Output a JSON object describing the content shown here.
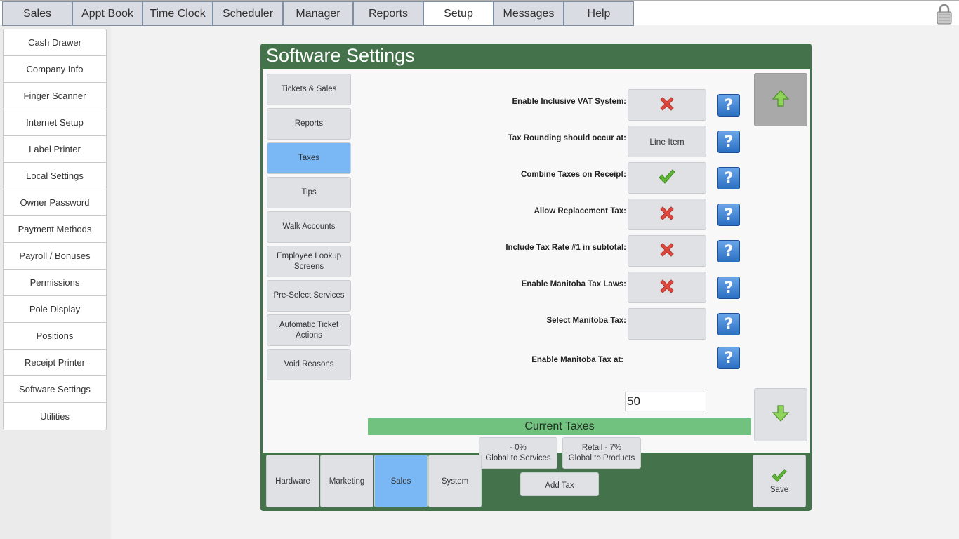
{
  "topnav": {
    "tabs": [
      {
        "label": "Sales"
      },
      {
        "label": "Appt Book"
      },
      {
        "label": "Time Clock"
      },
      {
        "label": "Scheduler"
      },
      {
        "label": "Manager"
      },
      {
        "label": "Reports"
      },
      {
        "label": "Setup",
        "active": true
      },
      {
        "label": "Messages"
      },
      {
        "label": "Help"
      }
    ],
    "lock_icon": "padlock-icon"
  },
  "sidebar": {
    "items": [
      {
        "label": "Cash Drawer"
      },
      {
        "label": "Company Info"
      },
      {
        "label": "Finger Scanner"
      },
      {
        "label": "Internet Setup"
      },
      {
        "label": "Label Printer"
      },
      {
        "label": "Local Settings"
      },
      {
        "label": "Owner Password"
      },
      {
        "label": "Payment Methods"
      },
      {
        "label": "Payroll / Bonuses"
      },
      {
        "label": "Permissions"
      },
      {
        "label": "Pole Display"
      },
      {
        "label": "Positions"
      },
      {
        "label": "Receipt Printer"
      },
      {
        "label": "Software Settings"
      },
      {
        "label": "Utilities"
      }
    ]
  },
  "panel": {
    "title": "Software Settings",
    "categories": [
      {
        "label": "Tickets & Sales"
      },
      {
        "label": "Reports"
      },
      {
        "label": "Taxes",
        "active": true
      },
      {
        "label": "Tips"
      },
      {
        "label": "Walk Accounts"
      },
      {
        "label": "Employee Lookup Screens"
      },
      {
        "label": "Pre-Select Services"
      },
      {
        "label": "Automatic Ticket Actions"
      },
      {
        "label": "Void Reasons"
      }
    ],
    "settings": [
      {
        "label": "Enable Inclusive VAT System:",
        "state": "off"
      },
      {
        "label": "Tax Rounding should occur at:",
        "value": "Line Item"
      },
      {
        "label": "Combine Taxes on Receipt:",
        "state": "on"
      },
      {
        "label": "Allow Replacement Tax:",
        "state": "off"
      },
      {
        "label": "Include Tax Rate #1 in subtotal:",
        "state": "off"
      },
      {
        "label": "Enable Manitoba Tax Laws:",
        "state": "off"
      },
      {
        "label": "Select Manitoba Tax:",
        "value": ""
      },
      {
        "label": "Enable Manitoba Tax at:",
        "input_value": "50"
      }
    ],
    "help_glyph": "?",
    "current_taxes": {
      "heading": "Current Taxes",
      "taxes": [
        {
          "line1": "- 0%",
          "line2": "Global to Services"
        },
        {
          "line1": "Retail - 7%",
          "line2": "Global to Products"
        }
      ],
      "add_label": "Add Tax"
    },
    "bottom_tabs": [
      {
        "label": "Hardware"
      },
      {
        "label": "Marketing"
      },
      {
        "label": "Sales",
        "active": true
      },
      {
        "label": "System"
      }
    ],
    "save_label": "Save"
  },
  "colors": {
    "panel_green": "#44734b",
    "active_blue": "#7ab8f5",
    "taxes_bar": "#71c17f",
    "cross_red": "#e0483d",
    "check_green": "#5fb336"
  }
}
